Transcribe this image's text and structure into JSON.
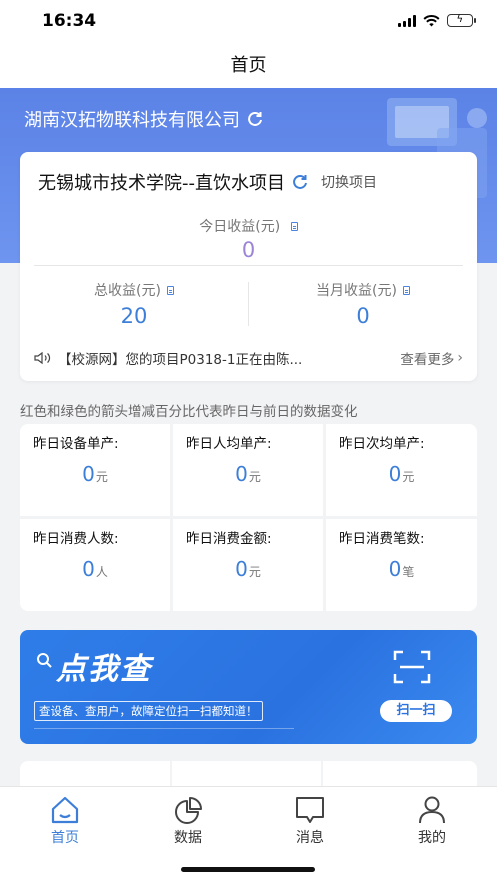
{
  "status": {
    "time": "16:34"
  },
  "nav": {
    "title": "首页"
  },
  "company": {
    "name": "湖南汉拓物联科技有限公司"
  },
  "project": {
    "name": "无锡城市技术学院--直饮水项目",
    "switch_label": "切换项目",
    "today_label": "今日收益(元)",
    "today_value": "0",
    "total_label": "总收益(元)",
    "total_value": "20",
    "month_label": "当月收益(元)",
    "month_value": "0",
    "notice_text": "【校源网】您的项目P0318-1正在由陈...",
    "notice_more": "查看更多"
  },
  "hint": "红色和绿色的箭头增减百分比代表昨日与前日的数据变化",
  "metrics": [
    {
      "label": "昨日设备单产:",
      "value": "0",
      "unit": "元"
    },
    {
      "label": "昨日人均单产:",
      "value": "0",
      "unit": "元"
    },
    {
      "label": "昨日次均单产:",
      "value": "0",
      "unit": "元"
    },
    {
      "label": "昨日消费人数:",
      "value": "0",
      "unit": "人"
    },
    {
      "label": "昨日消费金额:",
      "value": "0",
      "unit": "元"
    },
    {
      "label": "昨日消费笔数:",
      "value": "0",
      "unit": "笔"
    }
  ],
  "banner": {
    "title": "点我查",
    "subtitle": "查设备、查用户，故障定位扫一扫都知道！",
    "scan_label": "扫一扫"
  },
  "tabs": [
    {
      "label": "首页",
      "icon": "home-icon",
      "active": true
    },
    {
      "label": "数据",
      "icon": "pie-chart-icon",
      "active": false
    },
    {
      "label": "消息",
      "icon": "message-icon",
      "active": false
    },
    {
      "label": "我的",
      "icon": "user-icon",
      "active": false
    }
  ],
  "colors": {
    "primary": "#3d7fd8",
    "hero": "#5b82e6",
    "today_value": "#9b84d7",
    "banner": "#2a72e0"
  }
}
